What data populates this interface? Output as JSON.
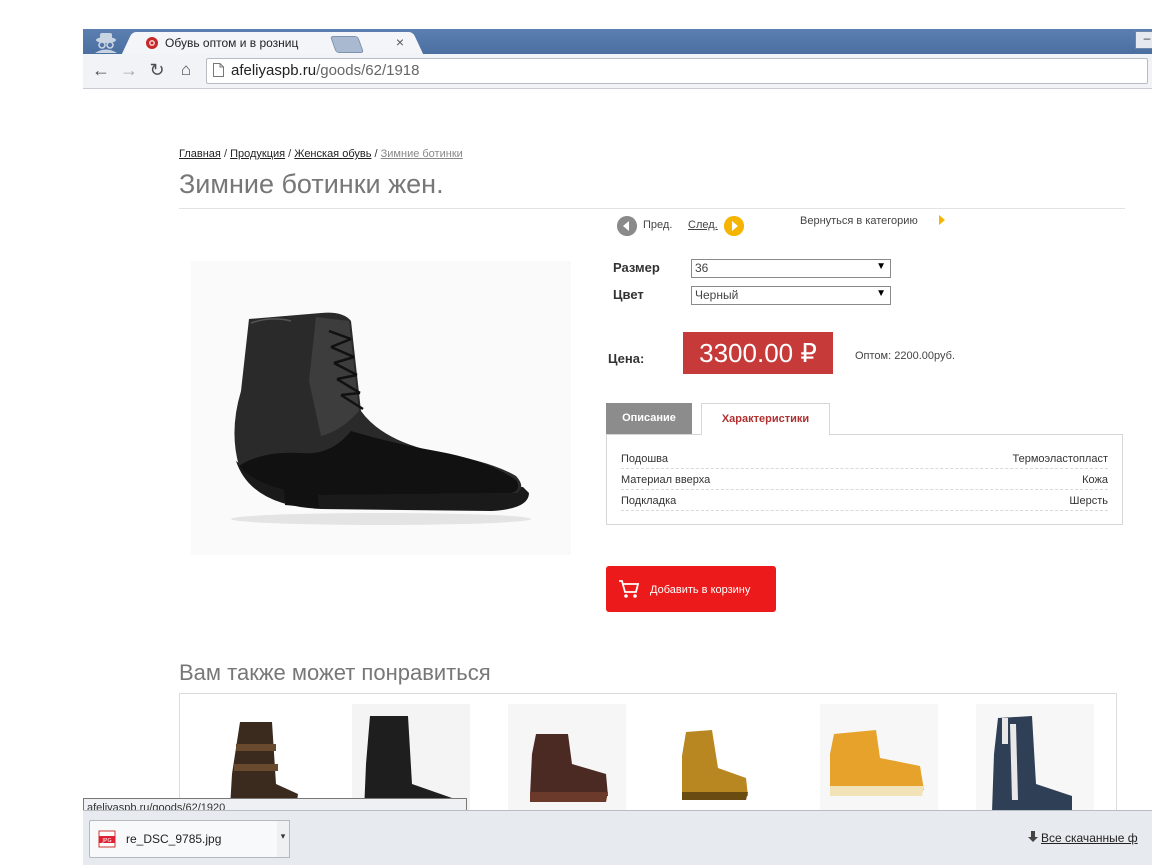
{
  "browser": {
    "tab_title": "Обувь оптом и в розниц",
    "url_host": "afeliyaspb.ru",
    "url_path": "/goods/62/1918"
  },
  "breadcrumb": {
    "home": "Главная",
    "products": "Продукция",
    "women": "Женская обувь",
    "current": "Зимние ботинки",
    "sep": "/"
  },
  "product": {
    "title": "Зимние ботинки жен.",
    "prev_label": "Пред.",
    "next_label": "След.",
    "back_to_category": "Вернуться в категорию",
    "size_label": "Размер",
    "size_value": "36",
    "color_label": "Цвет",
    "color_value": "Черный",
    "price_label": "Цена:",
    "price_value": "3300.00 ₽",
    "wholesale": "Оптом: 2200.00руб.",
    "tabs": [
      "Описание",
      "Характеристики"
    ],
    "active_tab": "Характеристики",
    "specs": [
      {
        "key": "Подошва",
        "value": "Термоэластопласт"
      },
      {
        "key": "Материал вверха",
        "value": "Кожа"
      },
      {
        "key": "Подкладка",
        "value": "Шерсть"
      }
    ],
    "add_to_cart": "Добавить в корзину"
  },
  "recommend": {
    "title": "Вам также может понравиться"
  },
  "status_bar": {
    "url": "afeliyaspb.ru/goods/62/1920"
  },
  "downloads": {
    "file_name": "re_DSC_9785.jpg",
    "show_all": "Все скачанные ф"
  },
  "colors": {
    "price_bg": "#c63a3a",
    "cart_bg": "#ec1a1a",
    "next_arrow": "#f4b400",
    "active_tab_text": "#b03030"
  },
  "icons": [
    "incognito-icon",
    "favicon-icon",
    "close-icon",
    "back-icon",
    "forward-icon",
    "reload-icon",
    "home-icon",
    "page-icon",
    "prev-arrow-icon",
    "next-arrow-icon",
    "cart-icon",
    "jpg-file-icon",
    "download-arrow-icon"
  ]
}
